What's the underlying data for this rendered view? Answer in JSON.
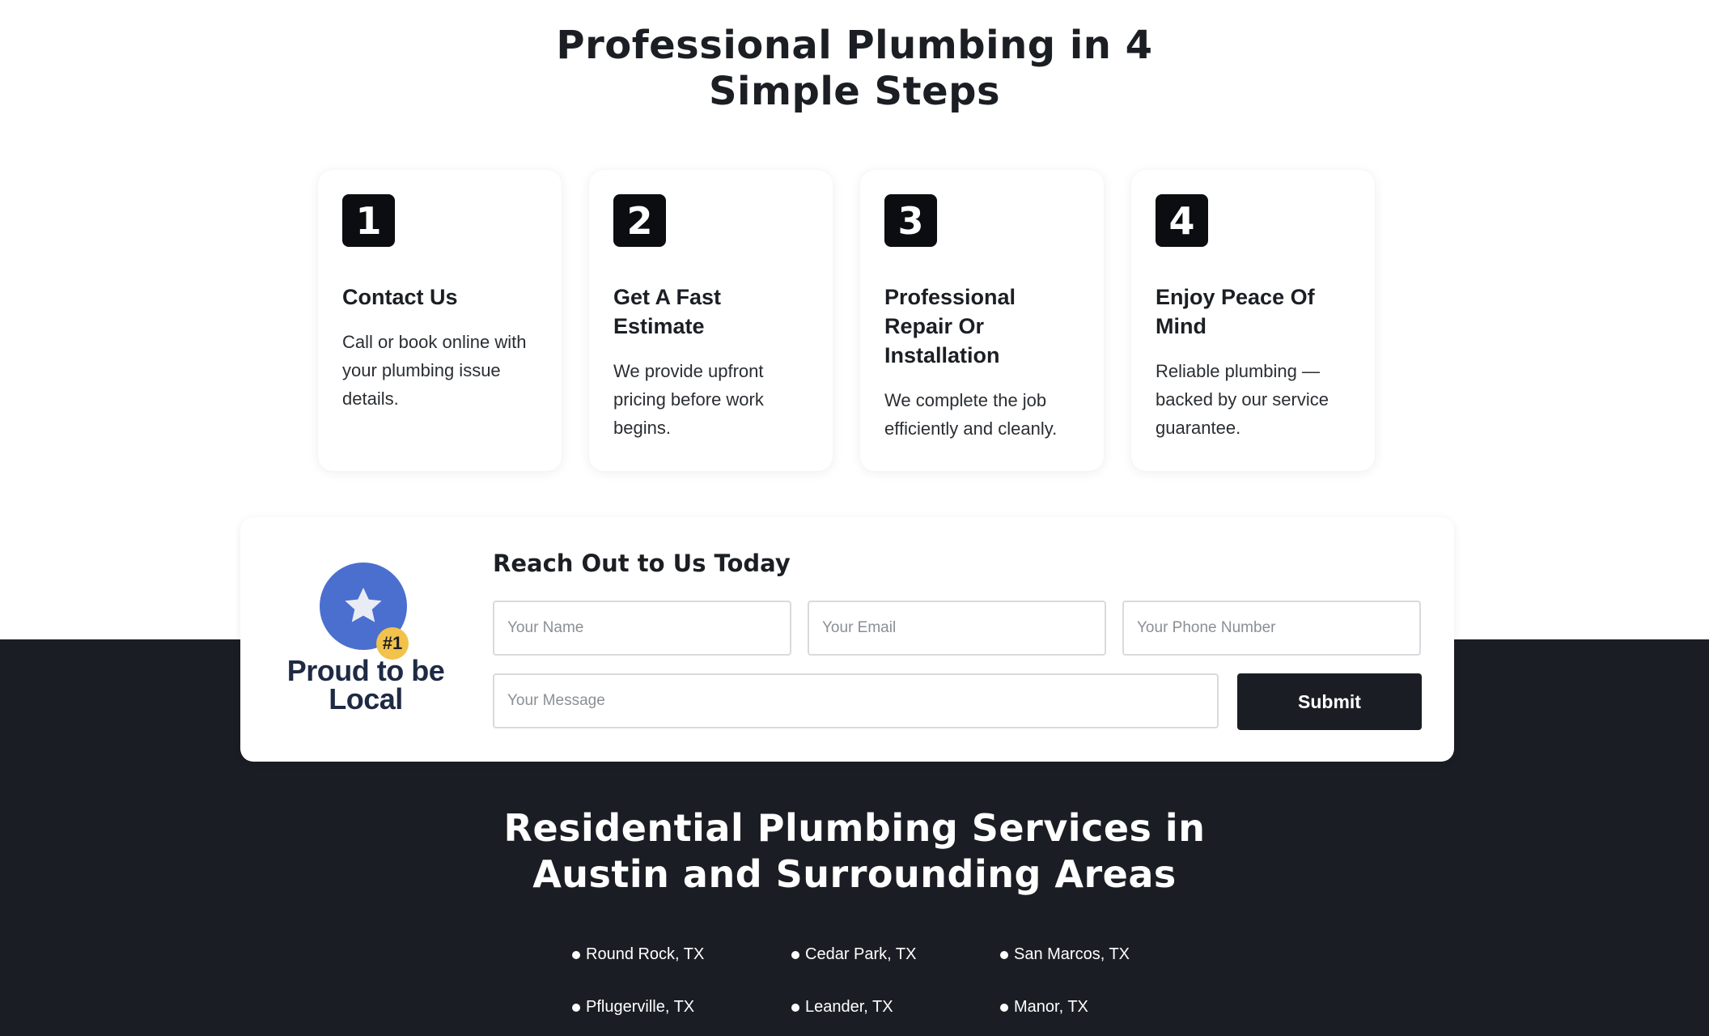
{
  "steps": {
    "title_line1": "Professional Plumbing in 4",
    "title_line2": "Simple Steps",
    "cards": [
      {
        "number": "1",
        "title": "Contact Us",
        "text": "Call or book online with your plumbing issue details."
      },
      {
        "number": "2",
        "title": "Get A Fast Estimate",
        "text": "We provide upfront pricing before work begins."
      },
      {
        "number": "3",
        "title": "Professional Repair Or Installation",
        "text": "We complete the job efficiently and cleanly."
      },
      {
        "number": "4",
        "title": "Enjoy Peace Of Mind",
        "text": "Reliable plumbing — backed by our service guarantee."
      }
    ]
  },
  "form": {
    "badge_number": "#1",
    "badge_text_line1": "Proud to be",
    "badge_text_line2": "Local",
    "title": "Reach Out to Us Today",
    "name_placeholder": "Your Name",
    "email_placeholder": "Your Email",
    "phone_placeholder": "Your Phone Number",
    "message_placeholder": "Your Message",
    "submit_label": "Submit"
  },
  "services": {
    "title_line1": "Residential Plumbing Services in",
    "title_line2": "Austin and Surrounding Areas",
    "areas": [
      "Round Rock, TX",
      "Cedar Park, TX",
      "San Marcos, TX",
      "Pflugerville, TX",
      "Leander, TX",
      "Manor, TX"
    ]
  },
  "colors": {
    "dark_bg": "#1a1e24",
    "badge_blue": "#4a6fcf",
    "badge_gold": "#f2c24b",
    "step_badge": "#0b0d10"
  },
  "icons": {
    "local_badge": "star-icon"
  }
}
